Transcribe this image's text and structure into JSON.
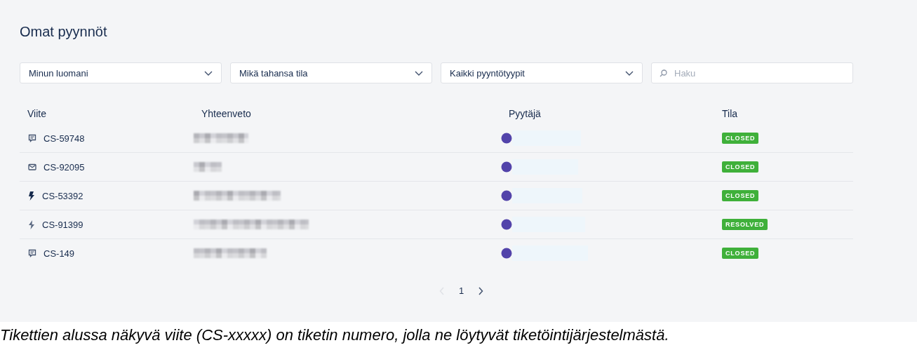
{
  "page_title": "Omat pyynnöt",
  "filters": [
    {
      "kind": "select",
      "value": "Minun luomani"
    },
    {
      "kind": "select",
      "value": "Mikä tahansa tila"
    },
    {
      "kind": "select",
      "value": "Kaikki pyyntötyypit"
    },
    {
      "kind": "search",
      "placeholder": "Haku"
    }
  ],
  "table": {
    "columns": [
      "Viite",
      "Yhteenveto",
      "Pyytäjä",
      "Tila"
    ],
    "rows": [
      {
        "kind": "chat",
        "reference": "CS-59748",
        "summary_blurred": true,
        "requester_blurred": true,
        "status": "CLOSED"
      },
      {
        "kind": "mail",
        "reference": "CS-92095",
        "summary_blurred": true,
        "requester_blurred": true,
        "status": "CLOSED"
      },
      {
        "kind": "bolt",
        "reference": "CS-53392",
        "summary_blurred": true,
        "requester_blurred": true,
        "status": "CLOSED"
      },
      {
        "kind": "bolt-light",
        "reference": "CS-91399",
        "summary_blurred": true,
        "requester_blurred": true,
        "status": "RESOLVED"
      },
      {
        "kind": "chat",
        "reference": "CS-149",
        "summary_blurred": true,
        "requester_blurred": true,
        "status": "CLOSED"
      }
    ]
  },
  "pagination": {
    "previous_disabled": true,
    "pages": [
      {
        "label": "1",
        "selected": true
      }
    ],
    "next_disabled": false
  },
  "caption": "Tikettien alussa näkyvä viite (CS-xxxxx) on tiketin numero, jolla ne löytyvät tiketöintijärjestelmästä."
}
